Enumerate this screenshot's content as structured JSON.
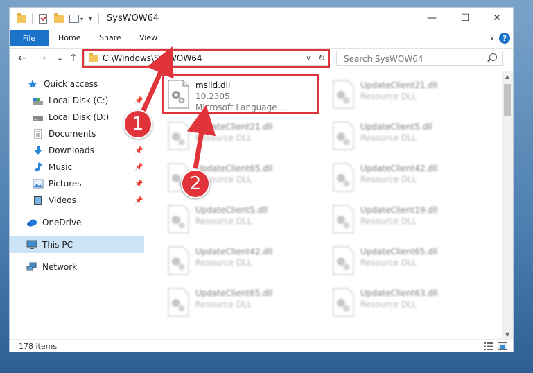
{
  "window": {
    "title": "SysWOW64",
    "minimize_glyph": "—",
    "maximize_glyph": "☐",
    "close_glyph": "✕"
  },
  "ribbon": {
    "tabs": [
      "File",
      "Home",
      "Share",
      "View"
    ],
    "help_glyph": "?",
    "collapse_glyph": "∨"
  },
  "nav": {
    "back_glyph": "←",
    "forward_glyph": "→",
    "recent_glyph": "⌄",
    "up_glyph": "↑",
    "address": "C:\\Windows\\SysWOW64",
    "address_dropdown_glyph": "∨",
    "refresh_glyph": "↻",
    "search_placeholder": "Search SysWOW64"
  },
  "sidebar": {
    "items": [
      {
        "label": "Quick access",
        "icon": "star-icon"
      },
      {
        "label": "Local Disk (C:)",
        "icon": "drive-c-icon",
        "pinned": true
      },
      {
        "label": "Local Disk (D:)",
        "icon": "drive-d-icon"
      },
      {
        "label": "Documents",
        "icon": "documents-icon"
      },
      {
        "label": "Downloads",
        "icon": "downloads-icon",
        "pinned": true
      },
      {
        "label": "Music",
        "icon": "music-icon",
        "pinned": true
      },
      {
        "label": "Pictures",
        "icon": "pictures-icon",
        "pinned": true
      },
      {
        "label": "Videos",
        "icon": "videos-icon",
        "pinned": true
      },
      {
        "label": "OneDrive",
        "icon": "onedrive-icon"
      },
      {
        "label": "This PC",
        "icon": "this-pc-icon",
        "selected": true
      },
      {
        "label": "Network",
        "icon": "network-icon"
      }
    ],
    "pin_glyph": "📌"
  },
  "files": {
    "highlighted": {
      "name": "mslid.dll",
      "version": "10.2305",
      "description": "Microsoft Language ..."
    },
    "col1": [
      {
        "name": "UpdateClient21.dll",
        "type": "Resource DLL"
      },
      {
        "name": "UpdateClient65.dll",
        "type": "Resource DLL"
      },
      {
        "name": "UpdateClient5.dll",
        "type": "Resource DLL"
      },
      {
        "name": "UpdateClient42.dll",
        "type": "Resource DLL"
      },
      {
        "name": "UpdateClient65.dll",
        "type": "Resource DLL"
      }
    ],
    "col2": [
      {
        "name": "UpdateClient21.dll",
        "type": "Resource DLL"
      },
      {
        "name": "UpdateClient5.dll",
        "type": "Resource DLL"
      },
      {
        "name": "UpdateClient42.dll",
        "type": "Resource DLL"
      },
      {
        "name": "UpdateClient19.dll",
        "type": "Resource DLL"
      },
      {
        "name": "UpdateClient65.dll",
        "type": "Resource DLL"
      },
      {
        "name": "UpdateClient63.dll",
        "type": "Resource DLL"
      }
    ]
  },
  "status": {
    "item_count": "178 items"
  },
  "annotations": {
    "badge1": "1",
    "badge2": "2",
    "color": "#e0343a"
  },
  "scrollbar": {
    "up_glyph": "▲",
    "down_glyph": "▼"
  }
}
